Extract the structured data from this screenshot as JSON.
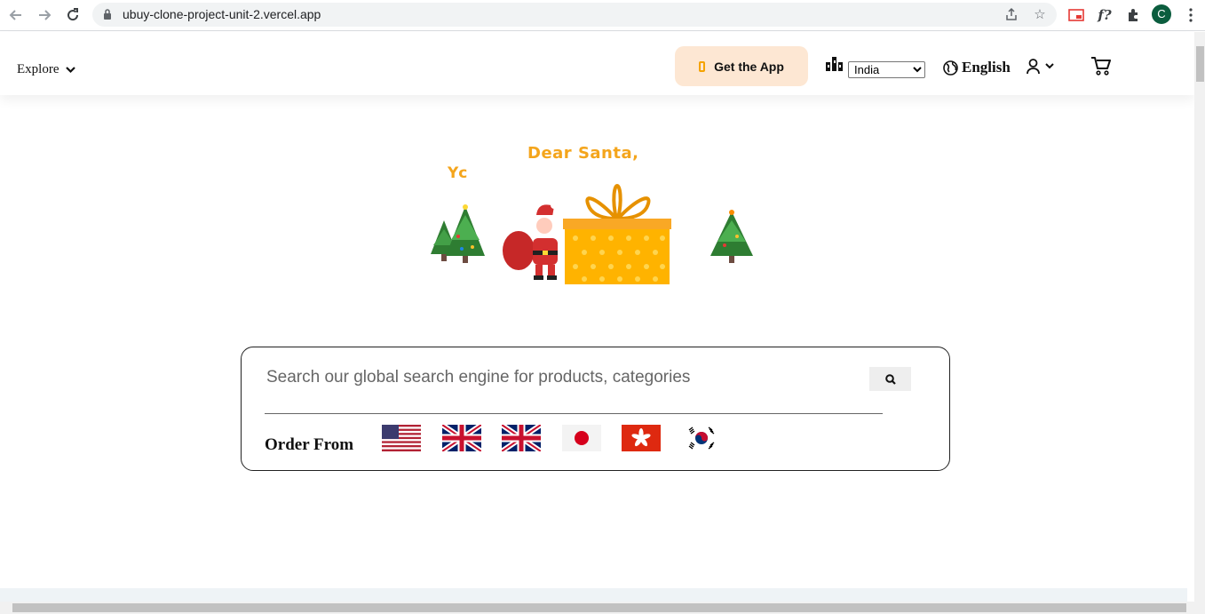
{
  "browser": {
    "url": "ubuy-clone-project-unit-2.vercel.app",
    "profile_initial": "C",
    "ext_label": "f?"
  },
  "header": {
    "explore_label": "Explore",
    "get_app_label": "Get the App",
    "country_selected": "India",
    "language_label": "English"
  },
  "hero": {
    "heading": "Dear Santa,",
    "partial_text": "Yc"
  },
  "search": {
    "placeholder": "Search our global search engine for products, categories",
    "order_from_label": "Order From",
    "flags": [
      "us-flag",
      "uk-flag",
      "uk-flag",
      "japan-flag",
      "hong-kong-flag",
      "south-korea-flag"
    ]
  },
  "colors": {
    "accent_orange": "#f4a51c",
    "get_app_bg": "#fde7d3",
    "avatar_bg": "#0b5d3e"
  }
}
